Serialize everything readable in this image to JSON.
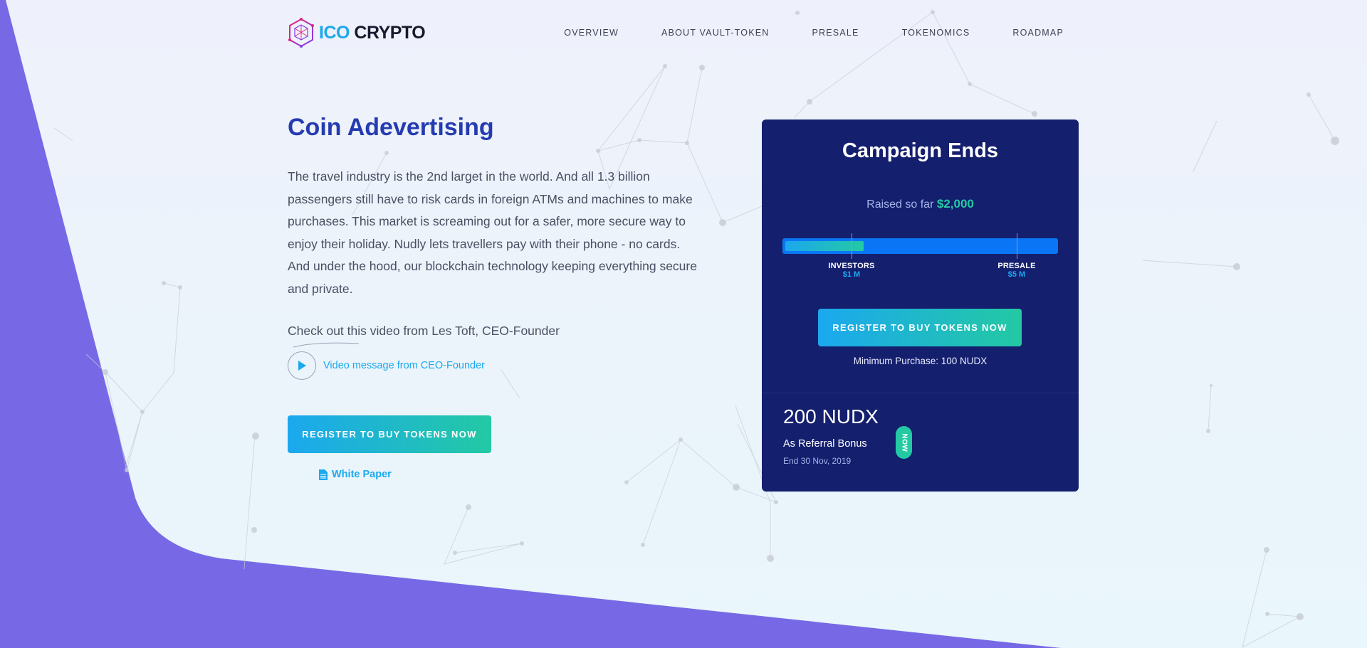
{
  "brand": {
    "name_part1": "ICO",
    "name_part2": "CRYPTO",
    "logo_icon": "hexagon-cube-icon",
    "colors": {
      "primary_blue": "#1ba8ef",
      "teal": "#23c9a3",
      "navy_card": "#141f6e",
      "heading_blue": "#253bb0",
      "purple_shape": "#7769e6"
    }
  },
  "nav": {
    "items": [
      {
        "label": "OVERVIEW"
      },
      {
        "label": "ABOUT VAULT-TOKEN"
      },
      {
        "label": "PRESALE"
      },
      {
        "label": "TOKENOMICS"
      },
      {
        "label": "ROADMAP"
      }
    ]
  },
  "hero": {
    "title": "Coin Adevertising",
    "description": "The travel industry is the 2nd larget in the world. And all 1.3 billion passengers still have to risk cards in foreign ATMs and machines to make purchases. This market is screaming out for a safer, more secure way to enjoy their holiday. Nudly lets travellers pay with their phone - no cards. And under the hood, our blockchain technology keeping everything secure and private.",
    "video_intro": "Check out this video from Les Toft, CEO-Founder",
    "video_link": "Video message from CEO-Founder",
    "video_icon": "play-icon",
    "register_button": "REGISTER TO BUY TOKENS NOW",
    "whitepaper_label": "White Paper",
    "whitepaper_icon": "document-icon"
  },
  "campaign": {
    "title": "Campaign Ends",
    "raised_prefix": "Raised so far",
    "raised_amount": "$2,000",
    "progress_fraction": 0.29,
    "markers": [
      {
        "name": "INVESTORS",
        "amount": "$1 M",
        "position_fraction": 0.25
      },
      {
        "name": "PRESALE",
        "amount": "$5 M",
        "position_fraction": 0.85
      }
    ],
    "register_button": "REGISTER TO BUY TOKENS NOW",
    "minimum_purchase": "Minimum Purchase: 100 NUDX",
    "bonus_amount": "200 NUDX",
    "bonus_label": "As Referral Bonus",
    "bonus_end": "End 30 Nov, 2019",
    "badge": "NOW"
  }
}
